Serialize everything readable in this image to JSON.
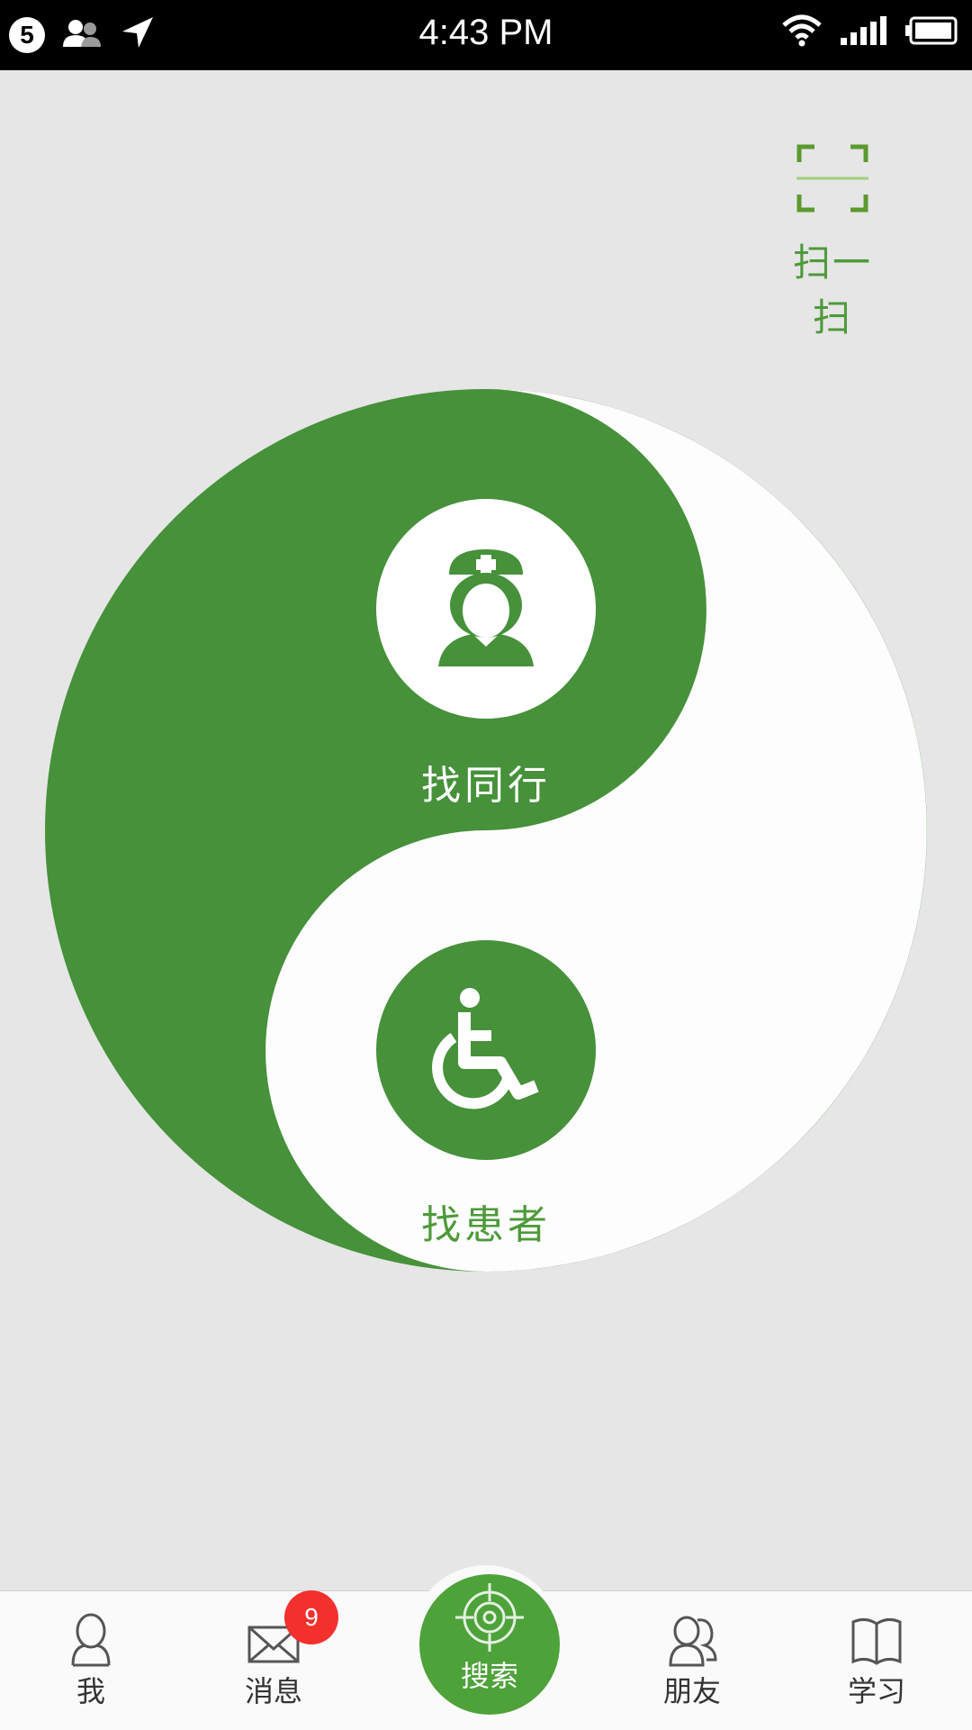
{
  "status_bar": {
    "notification_count": "5",
    "time": "4:43 PM",
    "icons": [
      "contacts-icon",
      "location-arrow-icon",
      "wifi-icon",
      "signal-icon",
      "battery-icon"
    ]
  },
  "scan": {
    "label": "扫一扫",
    "icon": "scan-frame-icon"
  },
  "main": {
    "find_colleague": {
      "label": "找同行",
      "icon": "nurse-icon"
    },
    "find_patient": {
      "label": "找患者",
      "icon": "wheelchair-icon"
    }
  },
  "tabbar": {
    "tabs": [
      {
        "label": "我",
        "icon": "person-icon"
      },
      {
        "label": "消息",
        "icon": "envelope-icon",
        "badge": "9"
      },
      {
        "label": "搜索",
        "icon": "crosshair-icon"
      },
      {
        "label": "朋友",
        "icon": "friends-icon"
      },
      {
        "label": "学习",
        "icon": "book-icon"
      }
    ]
  },
  "colors": {
    "accent_green": "#46913a",
    "badge_red": "#f2312d",
    "background": "#e6e6e6"
  }
}
